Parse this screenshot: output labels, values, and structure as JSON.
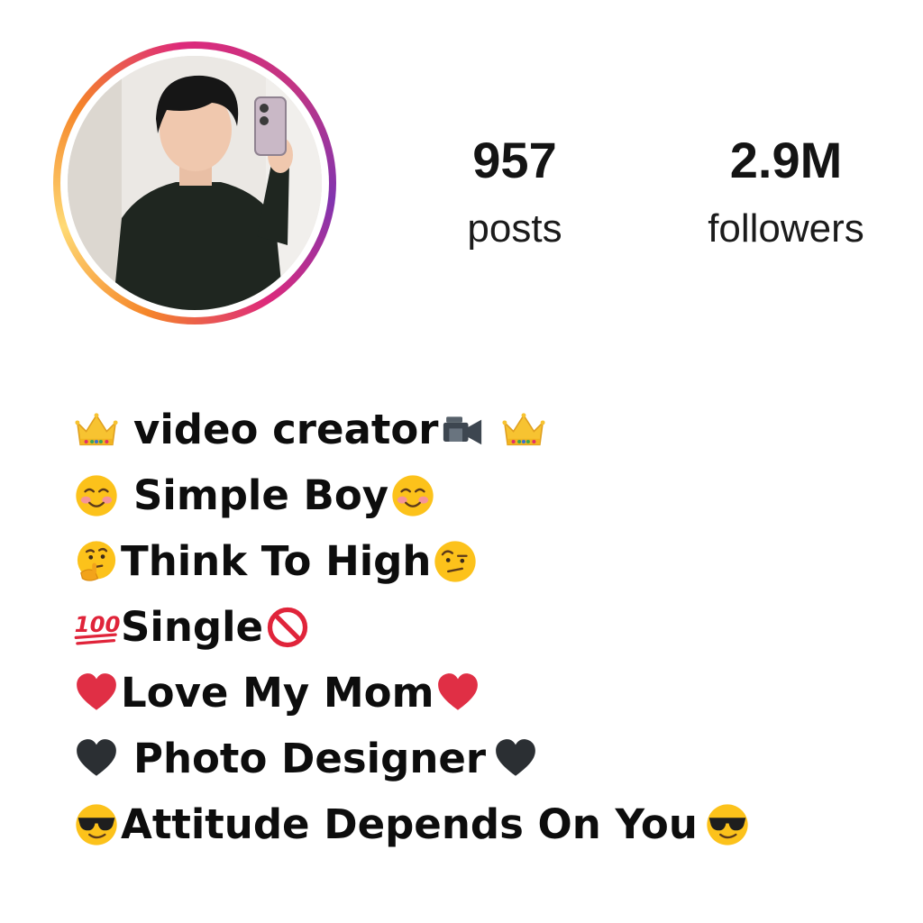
{
  "profile": {
    "avatar": {
      "icon": "profile-photo-mirror-selfie",
      "ring_colors": [
        "#f58529",
        "#feda75",
        "#dd2a7b",
        "#8134af"
      ]
    },
    "stats": {
      "posts": {
        "value": "957",
        "label": "posts"
      },
      "followers": {
        "value": "2.9M",
        "label": "followers"
      }
    },
    "bio": {
      "lines": [
        {
          "text": "video creator",
          "lead_icon": "crown-icon",
          "trail_icons": [
            "video-camera-icon",
            "crown-icon"
          ]
        },
        {
          "text": "Simple Boy",
          "lead_icon": "smiling-face-icon",
          "trail_icons": [
            "smiling-face-icon"
          ]
        },
        {
          "text": "Think To High",
          "lead_icon": "thinking-face-icon",
          "trail_icons": [
            "raised-eyebrow-face-icon"
          ]
        },
        {
          "text": "Single",
          "lead_icon": "hundred-points-icon",
          "trail_icons": [
            "prohibited-icon"
          ]
        },
        {
          "text": "Love My Mom",
          "lead_icon": "red-heart-icon",
          "trail_icons": [
            "red-heart-icon"
          ]
        },
        {
          "text": "Photo Designer",
          "lead_icon": "black-heart-icon",
          "trail_icons": [
            "black-heart-icon"
          ]
        },
        {
          "text": "Attitude Depends On You",
          "lead_icon": "sunglasses-face-icon",
          "trail_icons": [
            "sunglasses-face-icon"
          ]
        }
      ]
    }
  }
}
